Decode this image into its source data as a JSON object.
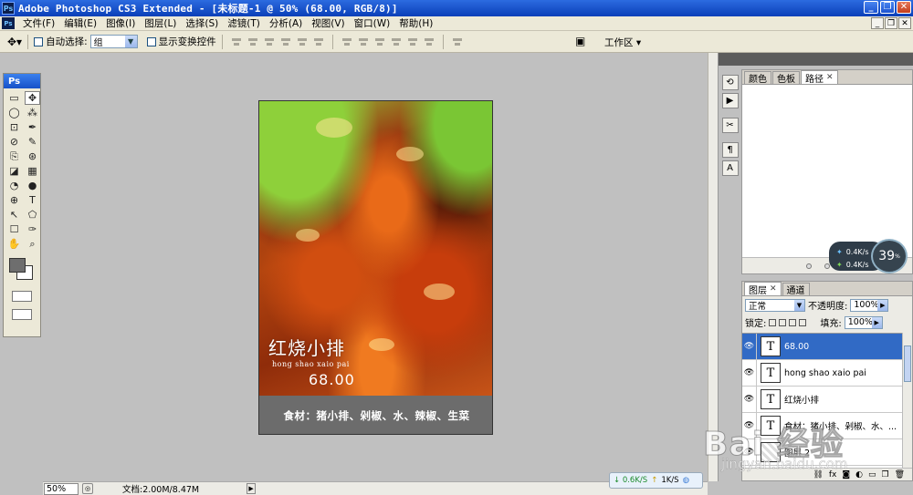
{
  "window": {
    "app_icon": "Ps",
    "title": "Adobe Photoshop CS3 Extended - [未标题-1 @ 50% (68.00, RGB/8)]",
    "minimize_glyph": "_",
    "maximize_glyph": "❐",
    "close_glyph": "✕"
  },
  "menubar": {
    "items": [
      "文件(F)",
      "编辑(E)",
      "图像(I)",
      "图层(L)",
      "选择(S)",
      "滤镜(T)",
      "分析(A)",
      "视图(V)",
      "窗口(W)",
      "帮助(H)"
    ]
  },
  "options": {
    "auto_select_label": "自动选择:",
    "auto_select_value": "组",
    "show_transform_label": "显示变换控件",
    "workspace_label": "工作区 ▾"
  },
  "toolbox": {
    "header": "Ps",
    "tools": [
      "▭",
      "✥",
      "◯",
      "⁂",
      "⊡",
      "✒",
      "⊘",
      "✎",
      "⎘",
      "⊛",
      "◪",
      "▦",
      "◔",
      "●",
      "⊕",
      "T",
      "↖",
      "⬠",
      "☐",
      "✑",
      "✋",
      "⌕"
    ]
  },
  "document": {
    "dish_title": "红烧小排",
    "dish_pinyin": "hong shao xaio pai",
    "dish_price": "68.00",
    "ingredients": "食材：猪小排、剁椒、水、辣椒、生菜"
  },
  "panels": {
    "color_tabs": [
      "颜色",
      "色板",
      "路径"
    ],
    "layer_tabs": [
      "图层",
      "通道"
    ],
    "blend_mode": "正常",
    "opacity_label": "不透明度:",
    "opacity_value": "100%",
    "lock_label": "锁定:",
    "fill_label": "填充:",
    "fill_value": "100%",
    "layers": [
      {
        "thumb": "T",
        "name": "68.00",
        "active": true
      },
      {
        "thumb": "T",
        "name": "hong shao xaio pai",
        "active": false
      },
      {
        "thumb": "T",
        "name": "红烧小排",
        "active": false
      },
      {
        "thumb": "T",
        "name": "食材：猪小排、剁椒、水、...",
        "active": false
      },
      {
        "thumb": "",
        "name": "图层 2",
        "active": false
      }
    ],
    "dock_icons": [
      "⟲",
      "▶",
      "✂",
      "¶",
      "A"
    ]
  },
  "speed_widget": {
    "upload": "0.4K/s",
    "download": "0.4K/s",
    "percent": "39",
    "percent_unit": "%"
  },
  "status": {
    "zoom": "50%",
    "doc_info": "文档:2.00M/8.47M"
  },
  "netbar": {
    "down": "↓ 0.6K/S",
    "up": "↑",
    "up_value": "1K/S"
  },
  "watermark": {
    "main": "Bai 经验",
    "sub": "jingyan.baidu.com"
  }
}
